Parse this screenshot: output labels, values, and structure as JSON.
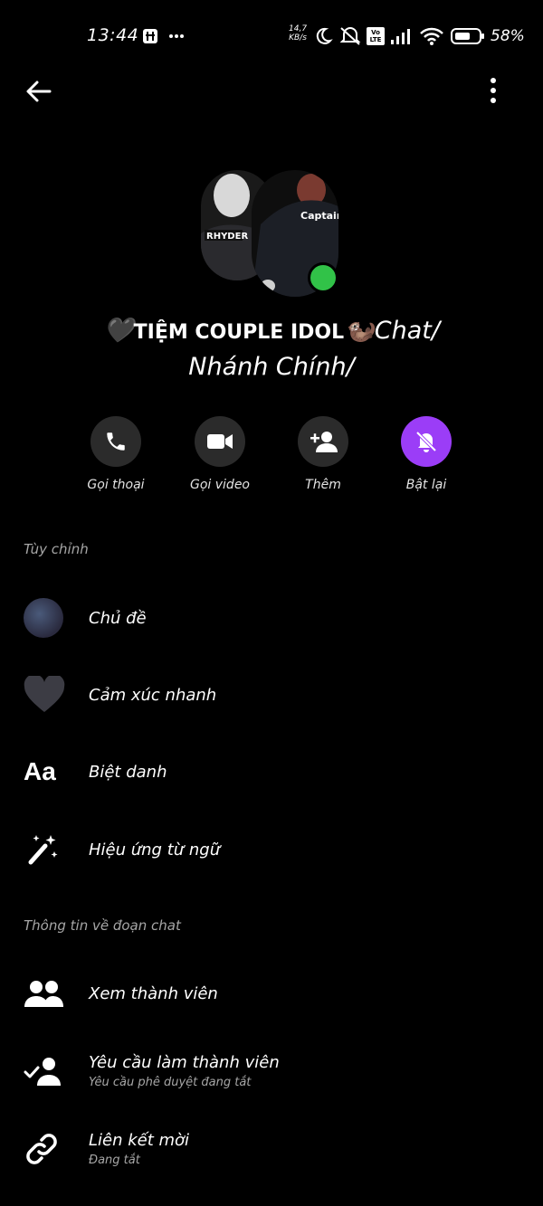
{
  "status_bar": {
    "time": "13:44",
    "net_speed_value": "14,7",
    "net_speed_unit": "KB/s",
    "volte": "Vo LTE",
    "battery_percent": "58%"
  },
  "header": {
    "back_icon": "back-arrow-icon",
    "more_icon": "more-vertical-icon"
  },
  "chat": {
    "title_bold": "TIỆM COUPLE IDOL",
    "title_after": "Chat/",
    "title_line2": "Nhánh Chính/",
    "online": true,
    "accent_color": "#9b3df7",
    "online_color": "#31c248"
  },
  "actions": [
    {
      "label": "Gọi thoại",
      "icon": "phone-icon"
    },
    {
      "label": "Gọi video",
      "icon": "video-camera-icon"
    },
    {
      "label": "Thêm",
      "icon": "add-person-icon"
    },
    {
      "label": "Bật lại",
      "icon": "bell-muted-icon"
    }
  ],
  "customize": {
    "heading": "Tùy chỉnh",
    "items": [
      {
        "label": "Chủ đề",
        "icon": "theme-icon"
      },
      {
        "label": "Cảm xúc nhanh",
        "icon": "black-heart-icon"
      },
      {
        "label": "Biệt danh",
        "icon": "text-aa-icon",
        "icon_text": "Aa"
      },
      {
        "label": "Hiệu ứng từ ngữ",
        "icon": "magic-wand-icon"
      }
    ]
  },
  "chat_info": {
    "heading": "Thông tin về đoạn chat",
    "items": [
      {
        "label": "Xem thành viên",
        "icon": "members-icon"
      },
      {
        "label": "Yêu cầu làm thành viên",
        "sublabel": "Yêu cầu phê duyệt đang tắt",
        "icon": "member-request-icon"
      },
      {
        "label": "Liên kết mời",
        "sublabel": "Đang tắt",
        "icon": "link-icon"
      }
    ]
  }
}
